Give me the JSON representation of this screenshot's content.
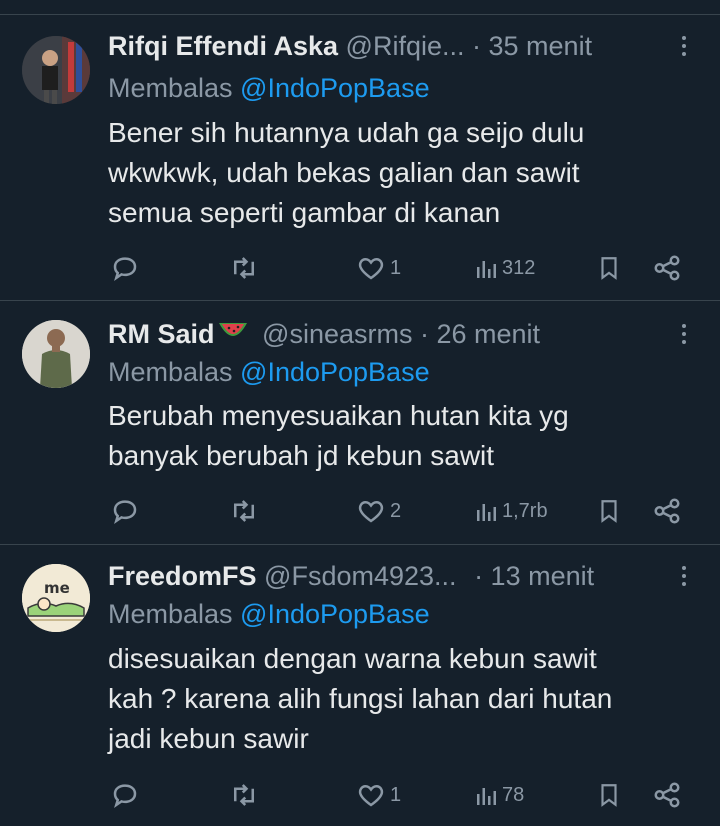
{
  "tweets": [
    {
      "name": "Rifqi Effendi Aska",
      "name_emoji": "",
      "handle": "@Rifqie...",
      "time": "· 35 menit",
      "reply_prefix": "Membalas ",
      "reply_to": "@IndoPopBase",
      "lines": [
        "Bener sih hutannya udah ga seijo dulu",
        "wkwkwk, udah bekas galian dan sawit",
        "semua seperti gambar di kanan"
      ],
      "likes": "1",
      "views": "312"
    },
    {
      "name": "RM Said",
      "name_emoji": "watermelon-emoji",
      "handle": "@sineasrms",
      "time": "· 26 menit",
      "reply_prefix": "Membalas ",
      "reply_to": "@IndoPopBase",
      "lines": [
        "Berubah menyesuaikan hutan kita yg",
        "banyak berubah jd kebun sawit"
      ],
      "likes": "2",
      "views": "1,7rb"
    },
    {
      "name": "FreedomFS",
      "name_emoji": "",
      "handle": "@Fsdom4923...",
      "time": "· 13 menit",
      "avatar_text": "me",
      "reply_prefix": "Membalas ",
      "reply_to": "@IndoPopBase",
      "lines": [
        "disesuaikan dengan warna kebun sawit",
        "kah ? karena alih fungsi lahan dari hutan",
        "jadi kebun sawir"
      ],
      "likes": "1",
      "views": "78"
    }
  ],
  "icons": {
    "reply": "reply-icon",
    "retweet": "retweet-icon",
    "like": "heart-icon",
    "views": "views-icon",
    "bookmark": "bookmark-icon",
    "share": "share-icon",
    "more": "more-icon"
  },
  "colors": {
    "background": "#15202b",
    "text": "#e7e9ea",
    "muted": "#8b98a5",
    "link": "#1d9bf0",
    "divider": "#38444d"
  }
}
